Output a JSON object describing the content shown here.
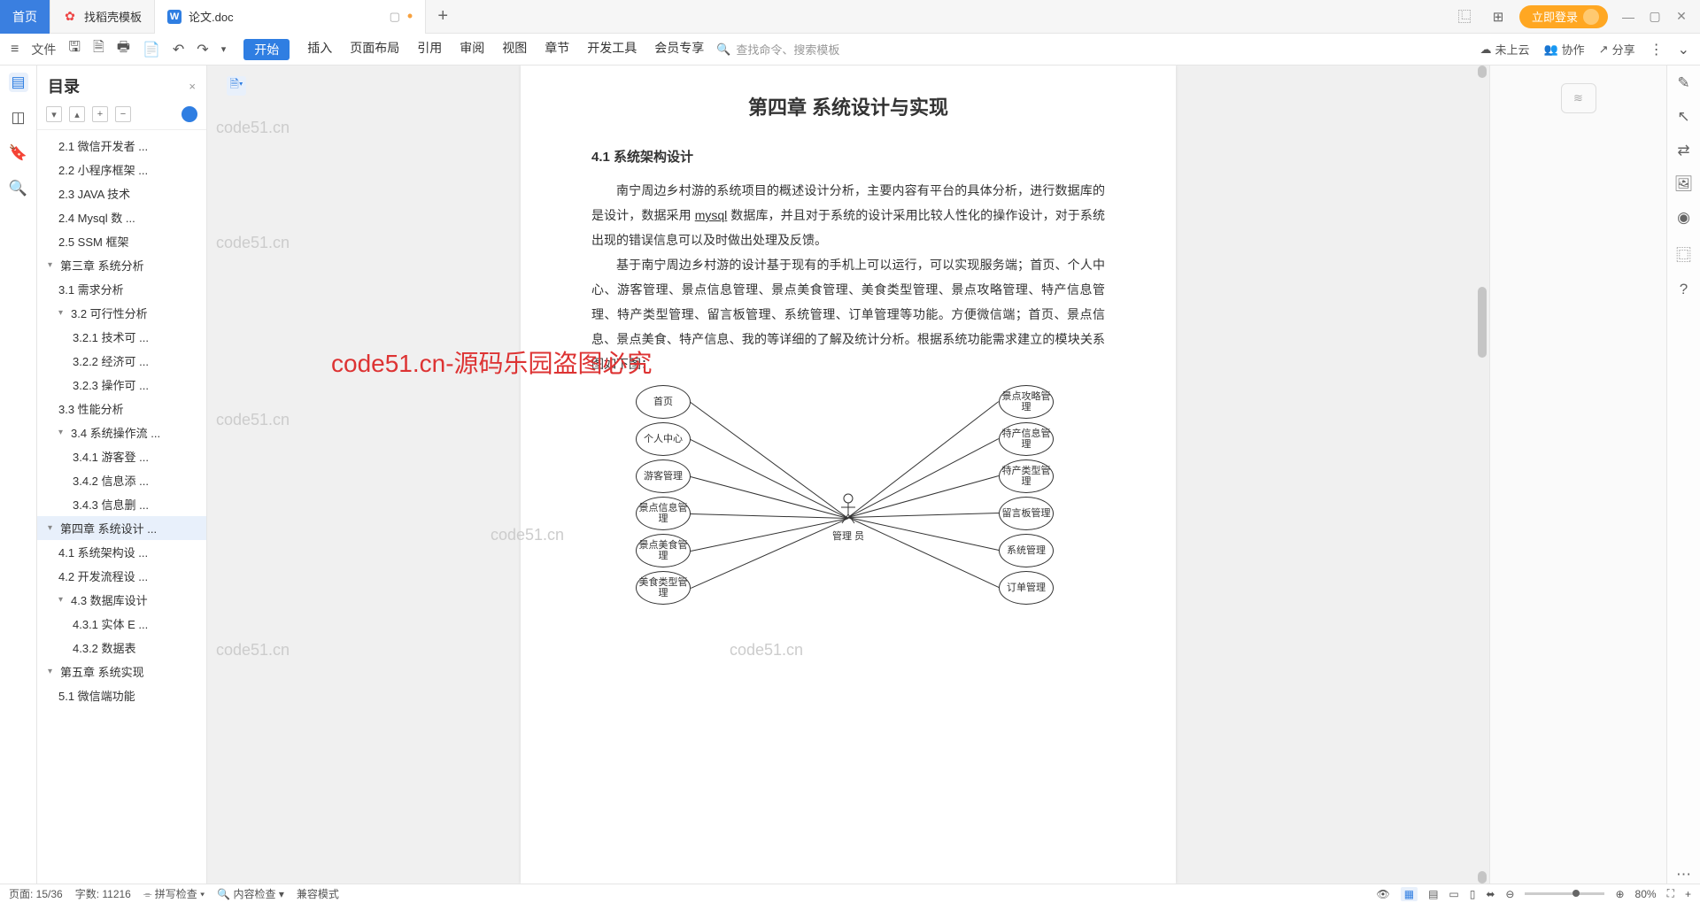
{
  "titlebar": {
    "tabs": [
      {
        "label": "首页",
        "kind": "home"
      },
      {
        "label": "找稻壳模板",
        "icon": "🔥",
        "iconColor": "#e44"
      },
      {
        "label": "论文.doc",
        "icon": "W",
        "iconColor": "#2f7ee2",
        "active": true
      }
    ],
    "login": "立即登录"
  },
  "toolbar": {
    "file": "文件",
    "menus": [
      "开始",
      "插入",
      "页面布局",
      "引用",
      "审阅",
      "视图",
      "章节",
      "开发工具",
      "会员专享"
    ],
    "search_placeholder": "查找命令、搜索模板",
    "cloud": "未上云",
    "coop": "协作",
    "share": "分享"
  },
  "outline": {
    "title": "目录",
    "items": [
      {
        "t": "2.1 微信开发者 ...",
        "lv": 1
      },
      {
        "t": "2.2 小程序框架 ...",
        "lv": 1
      },
      {
        "t": "2.3 JAVA 技术",
        "lv": 1
      },
      {
        "t": "2.4   Mysql 数 ...",
        "lv": 1
      },
      {
        "t": "2.5 SSM 框架",
        "lv": 1
      },
      {
        "t": "第三章  系统分析",
        "lv": 0,
        "ar": "▾"
      },
      {
        "t": "3.1 需求分析",
        "lv": 1
      },
      {
        "t": "3.2 可行性分析",
        "lv": 1,
        "ar": "▾"
      },
      {
        "t": "3.2.1 技术可 ...",
        "lv": 2
      },
      {
        "t": "3.2.2 经济可 ...",
        "lv": 2
      },
      {
        "t": "3.2.3 操作可 ...",
        "lv": 2
      },
      {
        "t": "3.3 性能分析",
        "lv": 1
      },
      {
        "t": "3.4 系统操作流 ...",
        "lv": 1,
        "ar": "▾"
      },
      {
        "t": "3.4.1 游客登 ...",
        "lv": 2
      },
      {
        "t": "3.4.2 信息添 ...",
        "lv": 2
      },
      {
        "t": "3.4.3 信息删 ...",
        "lv": 2
      },
      {
        "t": "第四章  系统设计 ...",
        "lv": 0,
        "ar": "▾",
        "active": true
      },
      {
        "t": "4.1 系统架构设 ...",
        "lv": 1
      },
      {
        "t": "4.2 开发流程设 ...",
        "lv": 1
      },
      {
        "t": "4.3 数据库设计",
        "lv": 1,
        "ar": "▾"
      },
      {
        "t": "4.3.1 实体 E ...",
        "lv": 2
      },
      {
        "t": "4.3.2 数据表",
        "lv": 2
      },
      {
        "t": "第五章  系统实现",
        "lv": 0,
        "ar": "▾"
      },
      {
        "t": "5.1 微信端功能",
        "lv": 1
      }
    ]
  },
  "document": {
    "chapter_title": "第四章  系统设计与实现",
    "section_title": "4.1 系统架构设计",
    "para1_a": "南宁周边乡村游的系统项目的概述设计分析，主要内容有平台的具体分析，进行数据库的是设计，数据采用 ",
    "para1_u": "mysql",
    "para1_b": " 数据库，并且对于系统的设计采用比较人性化的操作设计，对于系统出现的错误信息可以及时做出处理及反馈。",
    "para2": "基于南宁周边乡村游的设计基于现有的手机上可以运行，可以实现服务端；首页、个人中心、游客管理、景点信息管理、景点美食管理、美食类型管理、景点攻略管理、特产信息管理、特产类型管理、留言板管理、系统管理、订单管理等功能。方便微信端；首页、景点信息、景点美食、特产信息、我的等详细的了解及统计分析。根据系统功能需求建立的模块关系图如下图：",
    "diagram": {
      "actor": "管理 员",
      "left": [
        "首页",
        "个人中心",
        "游客管理",
        "景点信息管理",
        "景点美食管理",
        "美食类型管理"
      ],
      "right": [
        "景点攻略管理",
        "特产信息管理",
        "特产类型管理",
        "留言板管理",
        "系统管理",
        "订单管理"
      ]
    }
  },
  "watermarks": {
    "text": "code51.cn",
    "red": "code51.cn-源码乐园盗图必究"
  },
  "statusbar": {
    "page": "页面: 15/36",
    "words": "字数: 11216",
    "spell": "拼写检查",
    "content": "内容检查",
    "compat": "兼容模式",
    "zoom": "80%"
  }
}
